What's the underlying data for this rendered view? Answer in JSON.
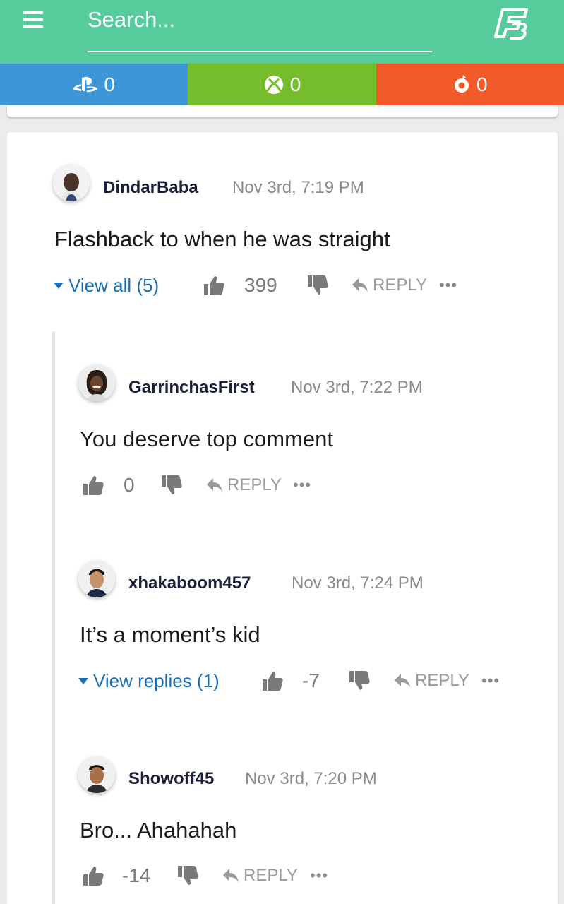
{
  "header": {
    "search_placeholder": "Search..."
  },
  "platforms": [
    {
      "name": "playstation-icon",
      "count": "0",
      "color": "#3d97d6"
    },
    {
      "name": "xbox-icon",
      "count": "0",
      "color": "#76bd2c"
    },
    {
      "name": "origin-icon",
      "count": "0",
      "color": "#f25a29"
    }
  ],
  "comments": [
    {
      "username": "DindarBaba",
      "time": "Nov 3rd, 7:19 PM",
      "text": "Flashback to when he was straight",
      "view_label": "View all (5)",
      "likes": "399",
      "reply_label": "REPLY",
      "more": "•••"
    },
    {
      "username": "GarrinchasFirst",
      "time": "Nov 3rd, 7:22 PM",
      "text": "You deserve top comment",
      "likes": "0",
      "reply_label": "REPLY",
      "more": "•••"
    },
    {
      "username": "xhakaboom457",
      "time": "Nov 3rd, 7:24 PM",
      "text": "It’s a moment’s kid",
      "view_label": "View replies (1)",
      "likes": "-7",
      "reply_label": "REPLY",
      "more": "•••"
    },
    {
      "username": "Showoff45",
      "time": "Nov 3rd, 7:20 PM",
      "text": "Bro... Ahahahah",
      "likes": "-14",
      "reply_label": "REPLY",
      "more": "•••"
    }
  ],
  "colors": {
    "header_bg": "#56cc9d",
    "link": "#1a6fb4",
    "username": "#1b1f3a"
  }
}
